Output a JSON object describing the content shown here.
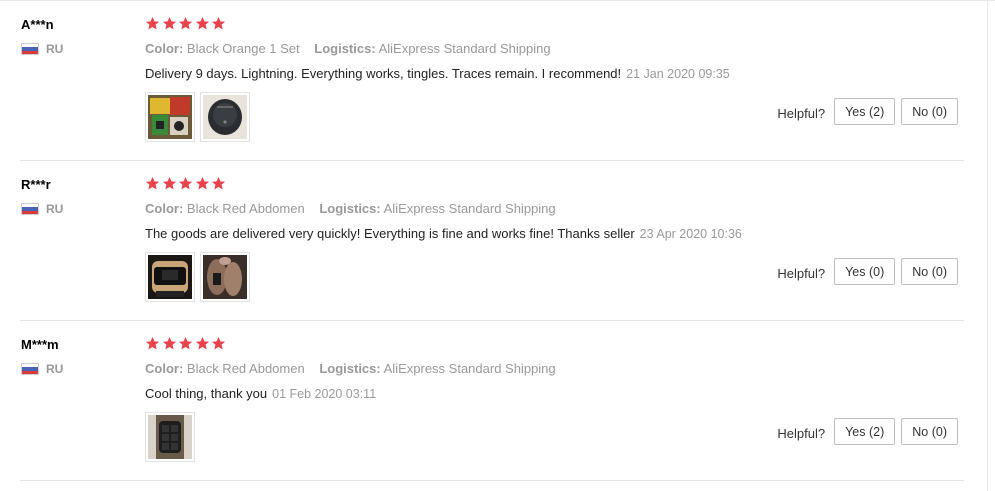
{
  "labels": {
    "color": "Color:",
    "logistics": "Logistics:",
    "helpful": "Helpful?"
  },
  "star_color": "#e8434a",
  "reviews": [
    {
      "user": "A***n",
      "country": "RU",
      "rating": 5,
      "color": "Black Orange 1 Set",
      "logistics": "AliExpress Standard Shipping",
      "text": "Delivery 9 days. Lightning. Everything works, tingles. Traces remain. I recommend!",
      "date": "21 Jan 2020 09:35",
      "photos": [
        "photo-product-box",
        "photo-round-device"
      ],
      "yes": "Yes (2)",
      "no": "No (0)"
    },
    {
      "user": "R***r",
      "country": "RU",
      "rating": 5,
      "color": "Black Red Abdomen",
      "logistics": "AliExpress Standard Shipping",
      "text": "The goods are delivered very quickly! Everything is fine and works fine! Thanks seller",
      "date": "23 Apr 2020 10:36",
      "photos": [
        "photo-abdomen-belt",
        "photo-body"
      ],
      "yes": "Yes (0)",
      "no": "No (0)"
    },
    {
      "user": "M***m",
      "country": "RU",
      "rating": 5,
      "color": "Black Red Abdomen",
      "logistics": "AliExpress Standard Shipping",
      "text": "Cool thing, thank you",
      "date": "01 Feb 2020 03:11",
      "photos": [
        "photo-abdomen-pad"
      ],
      "yes": "Yes (2)",
      "no": "No (0)"
    }
  ]
}
